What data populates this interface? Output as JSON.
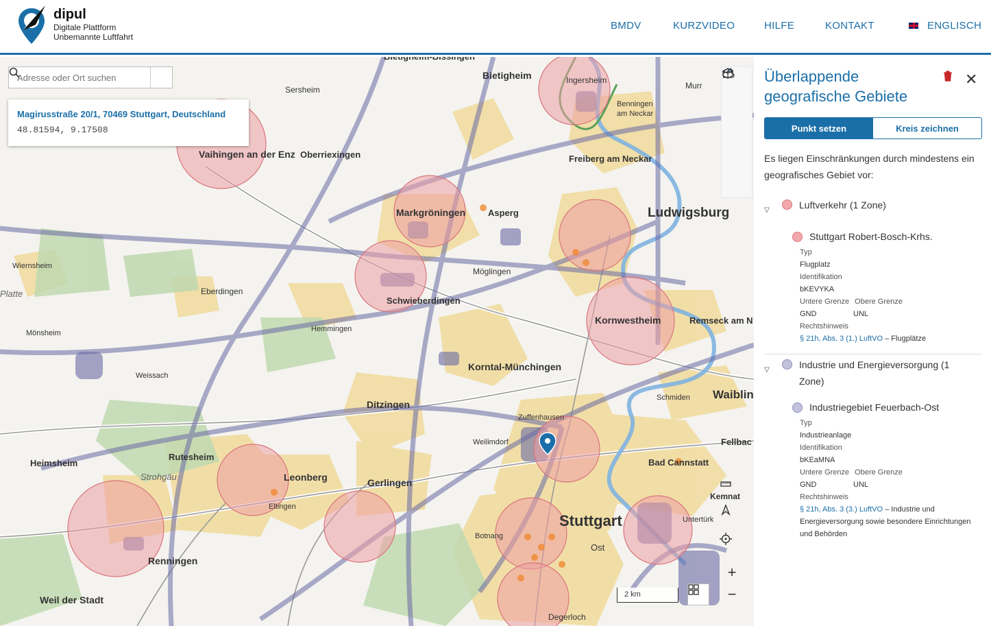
{
  "header": {
    "brand_name": "dipul",
    "brand_line1": "Digitale Plattform",
    "brand_line2": "Unbemannte Luftfahrt",
    "nav": [
      "BMDV",
      "KURZVIDEO",
      "HILFE",
      "KONTAKT"
    ],
    "language": "ENGLISCH"
  },
  "map": {
    "search_placeholder": "Adresse oder Ort suchen",
    "popup_address": "Magirusstraße 20/1, 70469 Stuttgart, Deutschland",
    "popup_coords": "48.81594, 9.17508",
    "scale_label": "2 km",
    "places": [
      "Bietigheim-Bissingen",
      "Bietigheim",
      "Sersheim",
      "Ingersheim",
      "Benningen am Neckar",
      "Murr",
      "Vaihingen an der Enz",
      "Oberriexingen",
      "Freiberg am Neckar",
      "Markgröningen",
      "Asperg",
      "Ludwigsburg",
      "Wiernsheim",
      "Eberdingen",
      "Schwieberdingen",
      "Möglingen",
      "Kornwestheim",
      "Remseck am N",
      "Mönsheim",
      "Hemmingen",
      "Weissach",
      "Korntal-Münchingen",
      "Ditzingen",
      "Zuffenhausen",
      "Weilimdorf",
      "Schmiden",
      "Waiblin",
      "Fellbach",
      "Heimsheim",
      "Rutesheim",
      "Leonberg",
      "Gerlingen",
      "Eltingen",
      "Stuttgart",
      "Bad Cannstatt",
      "Untertürk",
      "Renningen",
      "Botnang",
      "Ost",
      "Weil der Stadt",
      "Degerloch",
      "Kemnat",
      "Platte",
      "Strohgäu"
    ]
  },
  "panel": {
    "title": "Überlappende geografische Gebiete",
    "tab_point": "Punkt setzen",
    "tab_circle": "Kreis zeichnen",
    "intro": "Es liegen Einschränkungen durch mindestens ein geografisches Gebiet vor:",
    "section1": {
      "heading": "Luftverkehr (1 Zone)",
      "color": "#f2a9ab",
      "zone": "Stuttgart Robert-Bosch-Krhs.",
      "typ_label": "Typ",
      "typ": "Flugplatz",
      "id_label": "Identifikation",
      "id": "bKEVYKA",
      "lower_label": "Untere Grenze",
      "upper_label": "Obere Grenze",
      "lower": "GND",
      "upper": "UNL",
      "law_label": "Rechtshinweis",
      "law_link": "§ 21h, Abs. 3 (1.) LuftVO",
      "law_text": " – Flugplätze"
    },
    "section2": {
      "heading": "Industrie und Energieversorgung (1 Zone)",
      "color": "#c3c2dd",
      "zone": "Industriegebiet Feuerbach-Ost",
      "typ_label": "Typ",
      "typ": "Industrieanlage",
      "id_label": "Identifikation",
      "id": "bKEaMNA",
      "lower_label": "Untere Grenze",
      "upper_label": "Obere Grenze",
      "lower": "GND",
      "upper": "UNL",
      "law_label": "Rechtshinweis",
      "law_link": "§ 21h, Abs. 3 (3.) LuftVO",
      "law_text": " – Industrie und Energieversorgung sowie besondere Einrichtungen und Behörden"
    }
  }
}
